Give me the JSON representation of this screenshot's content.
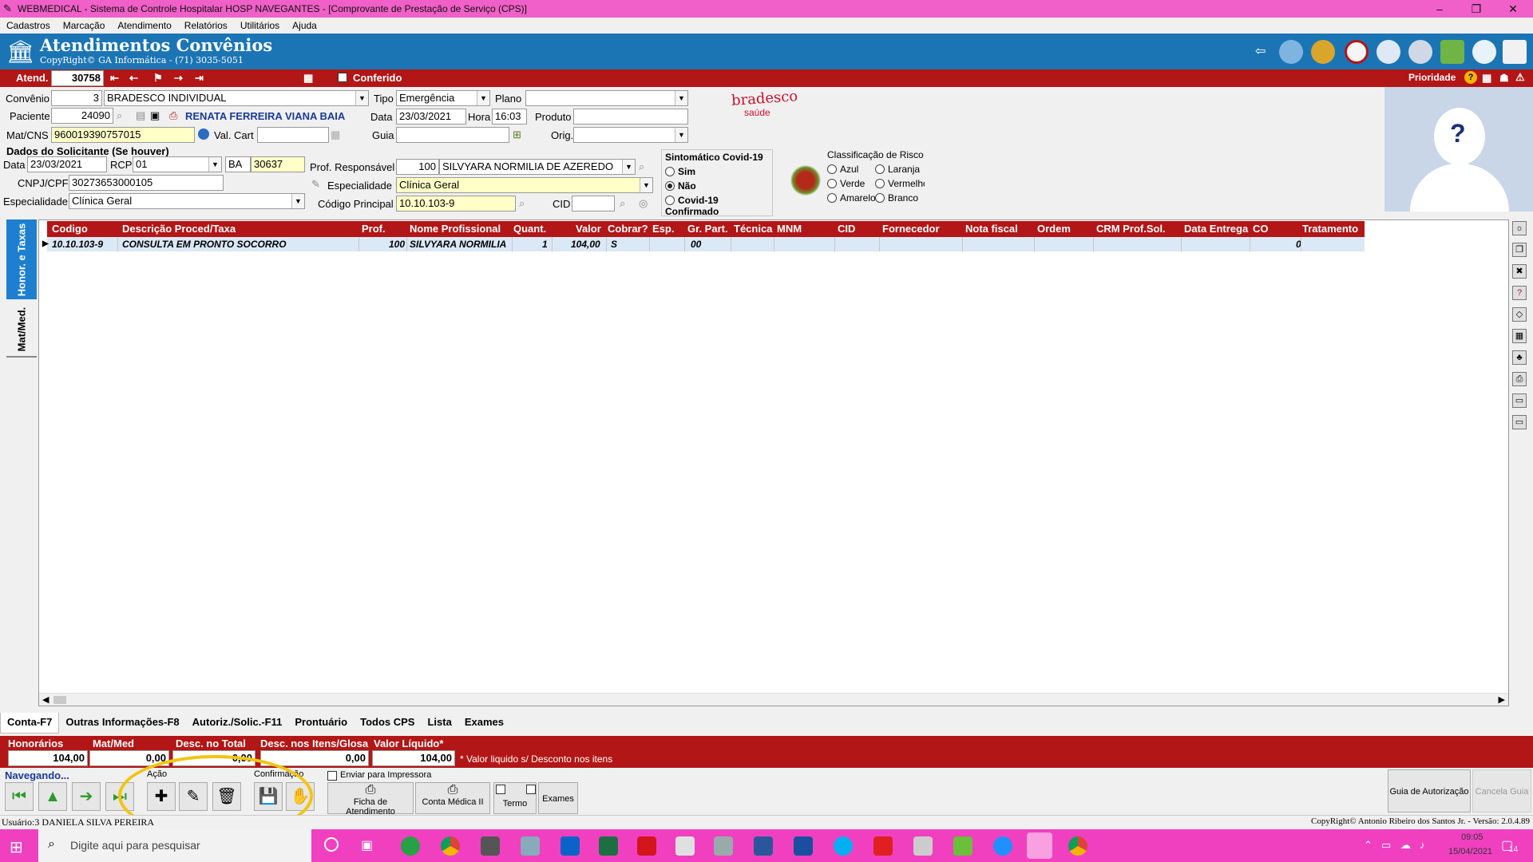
{
  "window": {
    "title": "WEBMEDICAL - Sistema de Controle Hospitalar HOSP NAVEGANTES - [Comprovante de Prestação de Serviço  (CPS)]",
    "minimize": "–",
    "restore": "❐",
    "close": "✕"
  },
  "menu": [
    "Cadastros",
    "Marcação",
    "Atendimento",
    "Relatórios",
    "Utilitários",
    "Ajuda"
  ],
  "header": {
    "title": "Atendimentos Convênios",
    "copyright": "CopyRight© GA Informática - (71) 3035-5051"
  },
  "atend_bar": {
    "atend_label": "Atend.",
    "atend_value": "30758",
    "conferido_label": "Conferido",
    "prioridade_label": "Prioridade"
  },
  "form": {
    "convenio_label": "Convênio",
    "convenio_code": "3",
    "convenio_name": "BRADESCO INDIVIDUAL",
    "tipo_label": "Tipo",
    "tipo_value": "Emergência",
    "plano_label": "Plano",
    "plano_value": "",
    "paciente_label": "Paciente",
    "paciente_code": "24090",
    "paciente_name": "RENATA FERREIRA VIANA BAIA",
    "data_label": "Data",
    "data_value": "23/03/2021",
    "hora_label": "Hora",
    "hora_value": "16:03",
    "produto_label": "Produto",
    "produto_value": "",
    "matcns_label": "Mat/CNS",
    "matcns_value": "960019390757015",
    "valcart_label": "Val. Cart",
    "valcart_value": "",
    "guia_label": "Guia",
    "guia_value": "",
    "orig_label": "Orig.",
    "orig_value": "",
    "solicitante_title": "Dados do Solicitante (Se houver)",
    "sol_data_label": "Data",
    "sol_data_value": "23/03/2021",
    "rcp_label": "RCP",
    "rcp_value": "01",
    "uf_value": "BA",
    "crm_value": "30637",
    "cnpj_label": "CNPJ/CPF",
    "cnpj_value": "30273653000105",
    "esp_label": "Especialidade",
    "esp_value": "Clínica Geral",
    "prof_resp_label": "Prof. Responsável",
    "prof_resp_code": "100",
    "prof_resp_name": "SILVYARA NORMILIA DE AZEREDO",
    "esp2_label": "Especialidade",
    "esp2_value": "Clínica Geral",
    "cod_principal_label": "Código Principal",
    "cod_principal_value": "10.10.103-9",
    "cid_label": "CID",
    "cid_value": ""
  },
  "logo": {
    "brand": "bradesco",
    "sub": "saúde"
  },
  "covid": {
    "title": "Sintomático Covid-19",
    "options": [
      "Sim",
      "Não",
      "Covid-19 Confirmado"
    ],
    "selected": "Não"
  },
  "risk": {
    "title": "Classificação de Risco",
    "options": [
      "Azul",
      "Laranja",
      "Verde",
      "Vermelho",
      "Amarelo",
      "Branco"
    ]
  },
  "side_tabs": [
    "Honor. e Taxas",
    "Mat/Med."
  ],
  "grid": {
    "columns": [
      "Codigo",
      "Descrição Proced/Taxa",
      "Prof.",
      "Nome Profissional",
      "Quant.",
      "Valor",
      "Cobrar?",
      "Esp.",
      "Gr. Part.",
      "Técnica",
      "MNM",
      "CID",
      "Fornecedor",
      "Nota fiscal",
      "Ordem",
      "CRM Prof.Sol.",
      "Data Entrega",
      "CO",
      "Tratamento"
    ],
    "rows": [
      {
        "codigo": "10.10.103-9",
        "descricao": "CONSULTA EM PRONTO SOCORRO",
        "prof": "100",
        "nome": "SILVYARA NORMILIA",
        "quant": "1",
        "valor": "104,00",
        "cobrar": "S",
        "gr_part": "00",
        "co": "0"
      }
    ]
  },
  "bottom_tabs": [
    "Conta-F7",
    "Outras Informações-F8",
    "Autoriz./Solic.-F11",
    "Prontuário",
    "Todos CPS",
    "Lista",
    "Exames"
  ],
  "totals": {
    "honorarios_label": "Honorários",
    "honorarios_value": "104,00",
    "matmed_label": "Mat/Med",
    "matmed_value": "0,00",
    "desc_total_label": "Desc. no Total",
    "desc_total_value": "0,00",
    "desc_itens_label": "Desc. nos Itens/Glosa",
    "desc_itens_value": "0,00",
    "liquido_label": "Valor Líquido*",
    "liquido_value": "104,00",
    "note": "* Valor liquido s/ Desconto nos itens"
  },
  "nav": {
    "navegando": "Navegando...",
    "acao": "Ação",
    "confirmacao": "Confirmação",
    "enviar_impressora": "Enviar para Impressora",
    "ficha": "Ficha de Atendimento",
    "conta_medica": "Conta Médica II",
    "termo": "Termo",
    "exames": "Exames",
    "guia_autorizacao": "Guia de Autorização",
    "cancela_guia": "Cancela Guia"
  },
  "status": {
    "user": "Usuário:3 DANIELA SILVA PEREIRA",
    "copyright": "CopyRight© Antonio Ribeiro dos Santos Jr. - Versão: 2.0.4.89"
  },
  "taskbar": {
    "search_placeholder": "Digite aqui para pesquisar",
    "time": "09:05",
    "date": "15/04/2021",
    "notif": "14"
  },
  "colors": {
    "title_bg": "#f060c8",
    "header_bg": "#1b75b5",
    "accent_red": "#b31616",
    "taskbar_bg": "#f040c0"
  }
}
